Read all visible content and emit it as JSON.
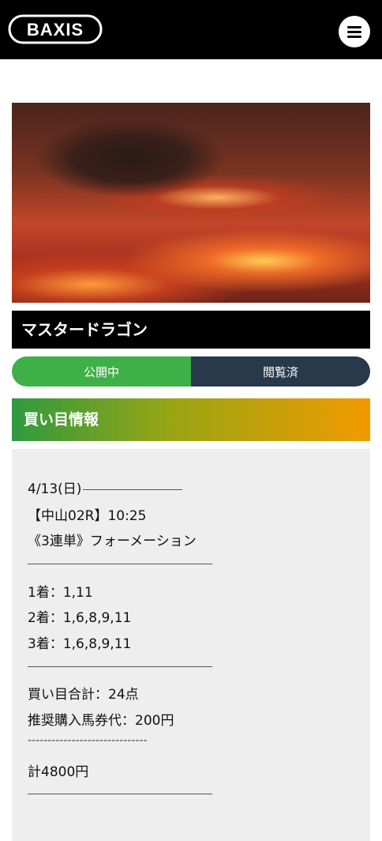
{
  "header": {
    "logo_text": "BAXIS",
    "menu_icon": "hamburger-menu-icon"
  },
  "colors": {
    "header_bg": "#000000",
    "public_green": "#3faf48",
    "viewed_navy": "#27394a",
    "section_gradient_start": "#2f9a3f",
    "section_gradient_end": "#f29a00",
    "content_bg": "#eeeeee"
  },
  "plan": {
    "title": "マスタードラゴン",
    "status_public": "公開中",
    "status_viewed": "閲覧済"
  },
  "section": {
    "title": "買い目情報"
  },
  "info": {
    "date": "4/13(日)",
    "race": "【中山02R】10:25",
    "bet_type": "《3連単》フォーメーション",
    "first": "1着：1,11",
    "second": "2着：1,6,8,9,11",
    "third": "3着：1,6,8,9,11",
    "total_points": "買い目合計：24点",
    "recommended": "推奨購入馬券代：200円",
    "dashes": "------------------------------",
    "grand_total": "計4800円"
  }
}
